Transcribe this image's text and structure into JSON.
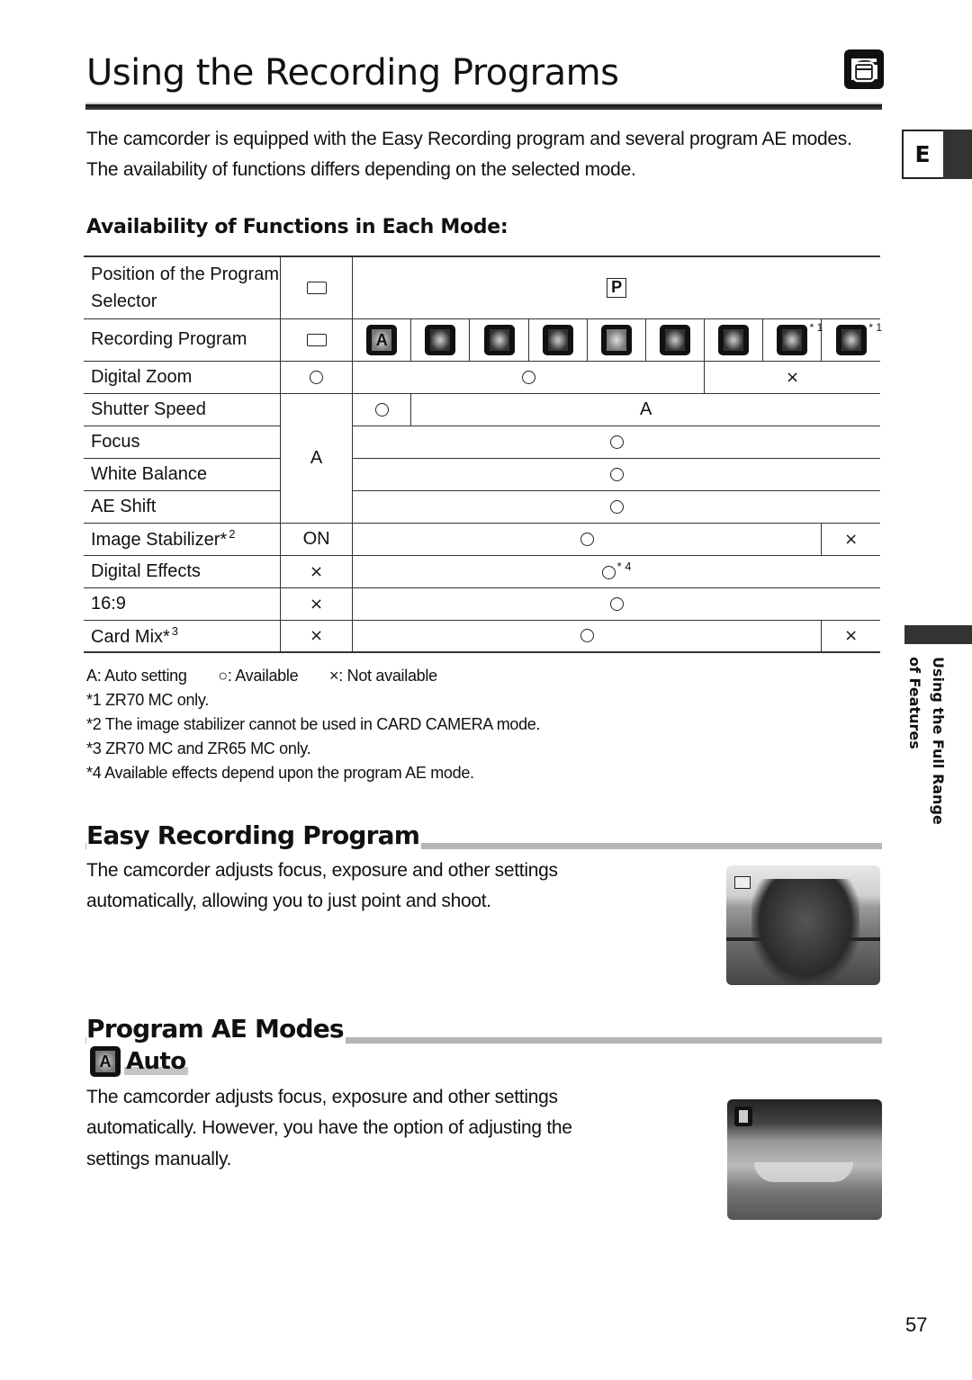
{
  "header": {
    "title": "Using the Recording Programs",
    "corner_icon": "camcorder-card-icon",
    "language_tab": "E"
  },
  "intro": "The camcorder is equipped with the Easy Recording program and several program AE modes. The availability of functions differs depending on the selected mode.",
  "availability": {
    "heading": "Availability of Functions in Each Mode:",
    "selector_row": {
      "label": "Position of the Program Selector",
      "easy_symbol": "easy-rect-icon",
      "program_symbol": "P"
    },
    "program_row": {
      "label": "Recording Program",
      "easy_symbol": "easy-rect-icon",
      "modes": [
        {
          "icon": "auto-mode-icon",
          "glyph": "A",
          "note": ""
        },
        {
          "icon": "sports-mode-icon",
          "glyph": "",
          "note": ""
        },
        {
          "icon": "portrait-mode-icon",
          "glyph": "",
          "note": ""
        },
        {
          "icon": "spotlight-mode-icon",
          "glyph": "",
          "note": ""
        },
        {
          "icon": "sand-snow-mode-icon",
          "glyph": "",
          "note": ""
        },
        {
          "icon": "low-light-mode-icon",
          "glyph": "",
          "note": ""
        },
        {
          "icon": "night-mode-icon",
          "glyph": "",
          "note": ""
        },
        {
          "icon": "fireworks-mode-icon",
          "glyph": "",
          "note": "* 1"
        },
        {
          "icon": "spotlight-plus-mode-icon",
          "glyph": "",
          "note": "* 1"
        }
      ]
    },
    "rows": {
      "digital_zoom": {
        "label": "Digital Zoom",
        "easy": "○",
        "p_main": "○",
        "p_last3": "×"
      },
      "shutter_speed": {
        "label": "Shutter Speed",
        "p_first": "○",
        "p_rest": "A"
      },
      "focus": {
        "label": "Focus",
        "easy": "A",
        "p": "○"
      },
      "white_balance": {
        "label": "White Balance",
        "p": "○"
      },
      "ae_shift": {
        "label": "AE Shift",
        "p": "○"
      },
      "image_stabilizer": {
        "label": "Image Stabilizer*",
        "note": "2",
        "easy": "ON",
        "p_main": "○",
        "p_last": "×"
      },
      "digital_effects": {
        "label": "Digital Effects",
        "easy": "×",
        "p": "○",
        "p_note": "* 4"
      },
      "widescreen": {
        "label": "16:9",
        "easy": "×",
        "p": "○"
      },
      "card_mix": {
        "label": "Card Mix*",
        "note": "3",
        "easy": "×",
        "p_main": "○",
        "p_last": "×"
      }
    },
    "legend": {
      "auto": "A: Auto setting",
      "available": "○: Available",
      "not_available": "×: Not available"
    },
    "footnotes": [
      "*1 ZR70 MC only.",
      "*2 The image stabilizer cannot be used in CARD CAMERA mode.",
      "*3 ZR70 MC and ZR65 MC only.",
      "*4 Available effects depend upon the program AE mode."
    ]
  },
  "side_tab": {
    "line1": "Using the Full Range",
    "line2": "of Features"
  },
  "easy_section": {
    "heading": "Easy Recording Program",
    "line1": "The camcorder adjusts focus, exposure and other settings",
    "line2": "automatically, allowing you to just point and shoot."
  },
  "program_section": {
    "heading": "Program AE Modes",
    "sub_heading": "Auto",
    "sub_glyph": "A",
    "line1": "The camcorder adjusts focus, exposure and other settings",
    "line2": "automatically. However, you have the option of adjusting the",
    "line3": "settings manually."
  },
  "page_number": "57"
}
